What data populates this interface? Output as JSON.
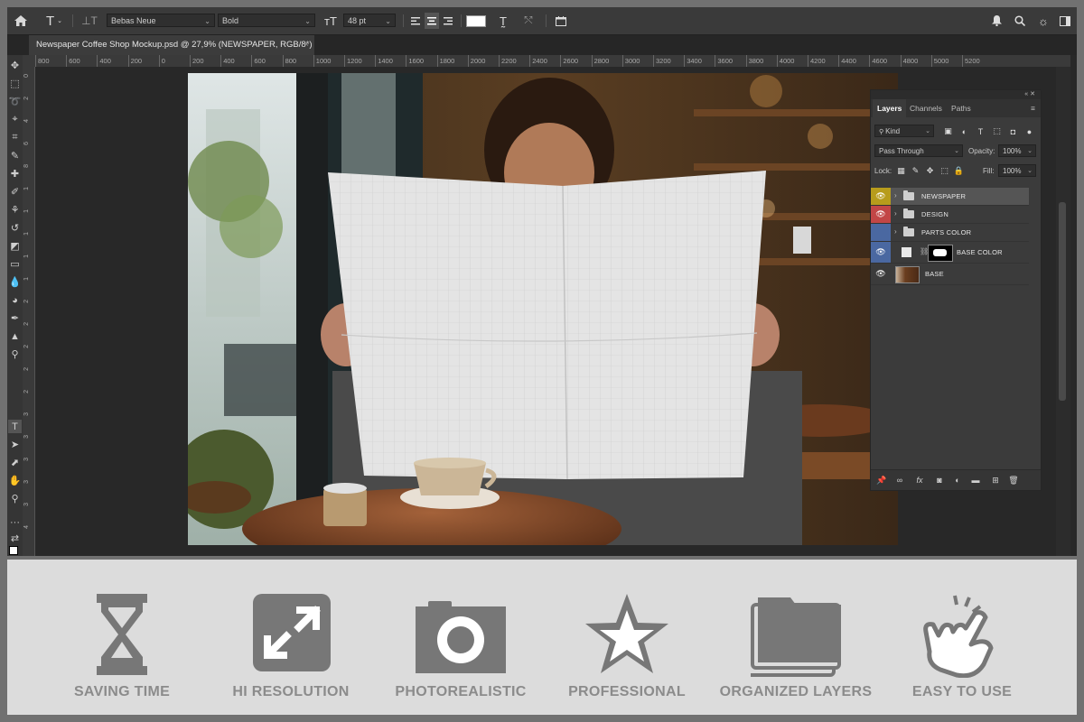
{
  "document": {
    "tab_title": "Newspaper Coffee Shop Mockup.psd @ 27,9% (NEWSPAPER, RGB/8*)"
  },
  "options_bar": {
    "font_family": "Bebas Neue",
    "font_style": "Bold",
    "font_size": "48 pt"
  },
  "ruler": {
    "h_ticks": [
      "800",
      "600",
      "400",
      "200",
      "0",
      "200",
      "400",
      "600",
      "800",
      "1000",
      "1200",
      "1400",
      "1600",
      "1800",
      "2000",
      "2200",
      "2400",
      "2600",
      "2800",
      "3000",
      "3200",
      "3400",
      "3600",
      "3800",
      "4000",
      "4200",
      "4400",
      "4600",
      "4800",
      "5000",
      "5200"
    ],
    "v_ticks": [
      "0",
      "2",
      "4",
      "6",
      "8",
      "1",
      "1",
      "1",
      "1",
      "1",
      "2",
      "2",
      "2",
      "2",
      "2",
      "3",
      "3",
      "3",
      "3",
      "3",
      "4"
    ]
  },
  "layers_panel": {
    "tabs": [
      "Layers",
      "Channels",
      "Paths"
    ],
    "kind_label": "Kind",
    "blend_mode": "Pass Through",
    "opacity_label": "Opacity:",
    "opacity_value": "100%",
    "lock_label": "Lock:",
    "fill_label": "Fill:",
    "fill_value": "100%",
    "layers": [
      {
        "name": "NEWSPAPER",
        "color": "#b79c1c",
        "type": "group",
        "visible": true,
        "selected": true
      },
      {
        "name": "DESIGN",
        "color": "#c24646",
        "type": "group",
        "visible": true,
        "selected": false
      },
      {
        "name": "PARTS COLOR",
        "color": "#4a68a1",
        "type": "group",
        "visible": false,
        "selected": false
      },
      {
        "name": "BASE COLOR",
        "color": "#4a68a1",
        "type": "fill",
        "visible": true,
        "selected": false
      },
      {
        "name": "BASE",
        "color": "#555555",
        "type": "image",
        "visible": true,
        "selected": false
      }
    ]
  },
  "features": [
    {
      "label": "SAVING TIME",
      "icon": "hourglass-icon"
    },
    {
      "label": "HI RESOLUTION",
      "icon": "expand-icon"
    },
    {
      "label": "PHOTOREALISTIC",
      "icon": "camera-icon"
    },
    {
      "label": "PROFESSIONAL",
      "icon": "star-icon"
    },
    {
      "label": "ORGANIZED LAYERS",
      "icon": "layers-icon"
    },
    {
      "label": "EASY TO USE",
      "icon": "pointer-hand-icon"
    }
  ]
}
